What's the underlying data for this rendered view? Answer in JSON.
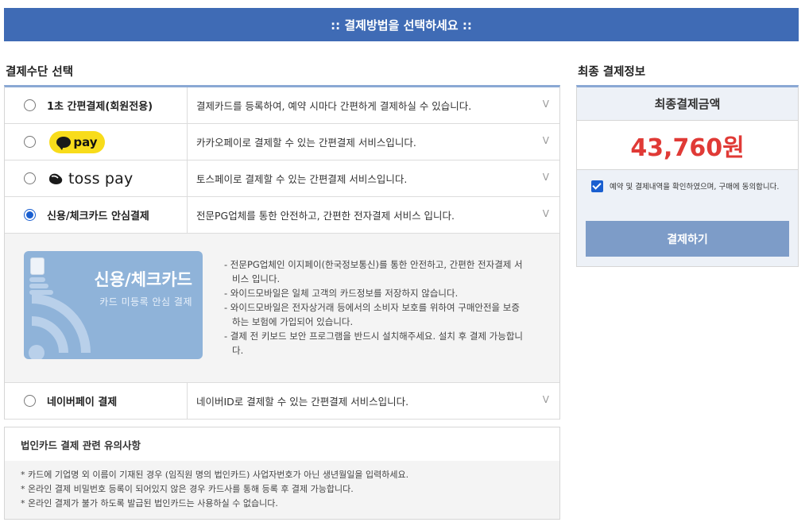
{
  "banner": ":: 결제방법을 선택하세요 ::",
  "methods_title": "결제수단 선택",
  "summary_title": "최종 결제정보",
  "methods": [
    {
      "label": "1초 간편결제(회원전용)",
      "desc": "결제카드를 등록하여, 예약 시마다 간편하게 결제하실 수 있습니다.",
      "selected": false
    },
    {
      "label": "pay",
      "logo": "kakaopay-logo",
      "desc": "카카오페이로 결제할 수 있는 간편결제 서비스입니다.",
      "selected": false
    },
    {
      "label": "toss pay",
      "logo": "tosspay-logo",
      "desc": "토스페이로 결제할 수 있는 간편결제 서비스입니다.",
      "selected": false
    },
    {
      "label": "신용/체크카드 안심결제",
      "desc": "전문PG업체를 통한 안전하고, 간편한 전자결제 서비스 입니다.",
      "selected": true
    },
    {
      "label": "네이버페이 결제",
      "desc": "네이버ID로 결제할 수 있는 간편결제 서비스입니다.",
      "selected": false
    }
  ],
  "chevron": "V",
  "card": {
    "title": "신용/체크카드",
    "subtitle": "카드 미등록 안심 결제"
  },
  "card_notes": [
    "- 전문PG업체인 이지페이(한국정보통신)를 통한 안전하고, 간편한 전자결제 서비스 입니다.",
    "- 와이드모바일은 일체 고객의 카드정보를 저장하지 않습니다.",
    "- 와이드모바일은 전자상거래 등에서의 소비자 보호를 위하여 구매안전을 보증하는 보험에 가입되어 있습니다.",
    "- 결제 전 키보드 보안 프로그램을 반드시 설치해주세요. 설치 후 결제 가능합니다."
  ],
  "corp": {
    "title": "법인카드 결제 관련 유의사항",
    "lines": [
      "* 카드에 기업명 외 이름이 기재된 경우 (임직원 명의 법인카드) 사업자번호가 아닌 생년월일을 입력하세요.",
      "* 온라인 결제 비밀번호 등록이 되어있지 않은 경우 카드사를 통해 등록 후 결제 가능합니다.",
      "* 온라인 결제가 불가 하도록 발급된 법인카드는 사용하실 수 없습니다."
    ]
  },
  "summary": {
    "heading": "최종결제금액",
    "amount": "43,760원",
    "agree_text": "예약 및 결제내역을 확인하였으며, 구매에 동의합니다.",
    "agree_checked": true,
    "pay_button": "결제하기"
  },
  "colors": {
    "banner": "#3f6bb5",
    "amount": "#e03a36",
    "button": "#7d9cc8",
    "kakao": "#f8dc1b"
  }
}
